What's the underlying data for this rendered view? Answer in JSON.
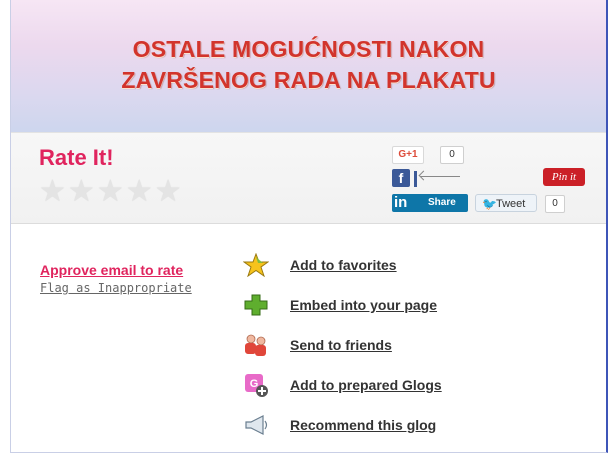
{
  "banner": {
    "line1": "OSTALE MOGUĆNOSTI NAKON",
    "line2": "ZAVRŠENOG RADA NA PLAKATU",
    "color": "#d2342c"
  },
  "rating": {
    "title": "Rate It!",
    "stars": [
      1,
      2,
      3,
      4,
      5
    ],
    "value": 0
  },
  "social": {
    "gplus_label": "G+1",
    "gplus_count": "0",
    "facebook_label": "f",
    "pinterest_label": "Pin it",
    "linkedin_logo": "in",
    "linkedin_label": "Share",
    "tweet_label": "Tweet",
    "tweet_count": "0"
  },
  "side_links": {
    "approve": "Approve email to rate",
    "flag": "Flag as Inappropriate"
  },
  "actions": [
    {
      "label": "Add to favorites",
      "icon": "star-icon"
    },
    {
      "label": "Embed into your page",
      "icon": "plus-icon"
    },
    {
      "label": "Send to friends",
      "icon": "friends-icon"
    },
    {
      "label": "Add to prepared Glogs",
      "icon": "glog-add-icon"
    },
    {
      "label": "Recommend this glog",
      "icon": "megaphone-icon"
    }
  ],
  "colors": {
    "accent": "#e0245e",
    "facebook": "#3b5998",
    "linkedin": "#0e76a8",
    "pinterest": "#cb2027",
    "twitter": "#2aa3ef"
  }
}
